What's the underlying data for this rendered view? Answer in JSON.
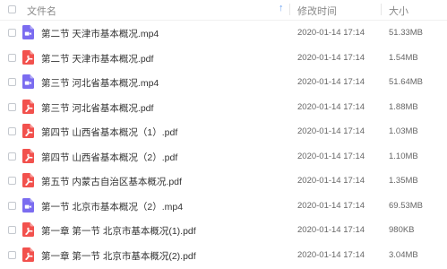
{
  "header": {
    "name_label": "文件名",
    "time_label": "修改时间",
    "size_label": "大小",
    "sort_indicator": "↑"
  },
  "files": [
    {
      "name": "第二节 天津市基本概况.mp4",
      "type": "video",
      "time": "2020-01-14 17:14",
      "size": "51.33MB"
    },
    {
      "name": "第二节 天津市基本概况.pdf",
      "type": "pdf",
      "time": "2020-01-14 17:14",
      "size": "1.54MB"
    },
    {
      "name": "第三节 河北省基本概况.mp4",
      "type": "video",
      "time": "2020-01-14 17:14",
      "size": "51.64MB"
    },
    {
      "name": "第三节 河北省基本概况.pdf",
      "type": "pdf",
      "time": "2020-01-14 17:14",
      "size": "1.88MB"
    },
    {
      "name": "第四节 山西省基本概况（1）.pdf",
      "type": "pdf",
      "time": "2020-01-14 17:14",
      "size": "1.03MB"
    },
    {
      "name": "第四节 山西省基本概况（2）.pdf",
      "type": "pdf",
      "time": "2020-01-14 17:14",
      "size": "1.10MB"
    },
    {
      "name": "第五节 内蒙古自治区基本概况.pdf",
      "type": "pdf",
      "time": "2020-01-14 17:14",
      "size": "1.35MB"
    },
    {
      "name": "第一节 北京市基本概况（2）.mp4",
      "type": "video",
      "time": "2020-01-14 17:14",
      "size": "69.53MB"
    },
    {
      "name": "第一章 第一节 北京市基本概况(1).pdf",
      "type": "pdf",
      "time": "2020-01-14 17:14",
      "size": "980KB"
    },
    {
      "name": "第一章 第一节 北京市基本概况(2).pdf",
      "type": "pdf",
      "time": "2020-01-14 17:14",
      "size": "3.04MB"
    }
  ],
  "colors": {
    "video_icon": "#7b6cf0",
    "pdf_icon": "#f2514d",
    "sort_arrow": "#6a9ff0"
  }
}
